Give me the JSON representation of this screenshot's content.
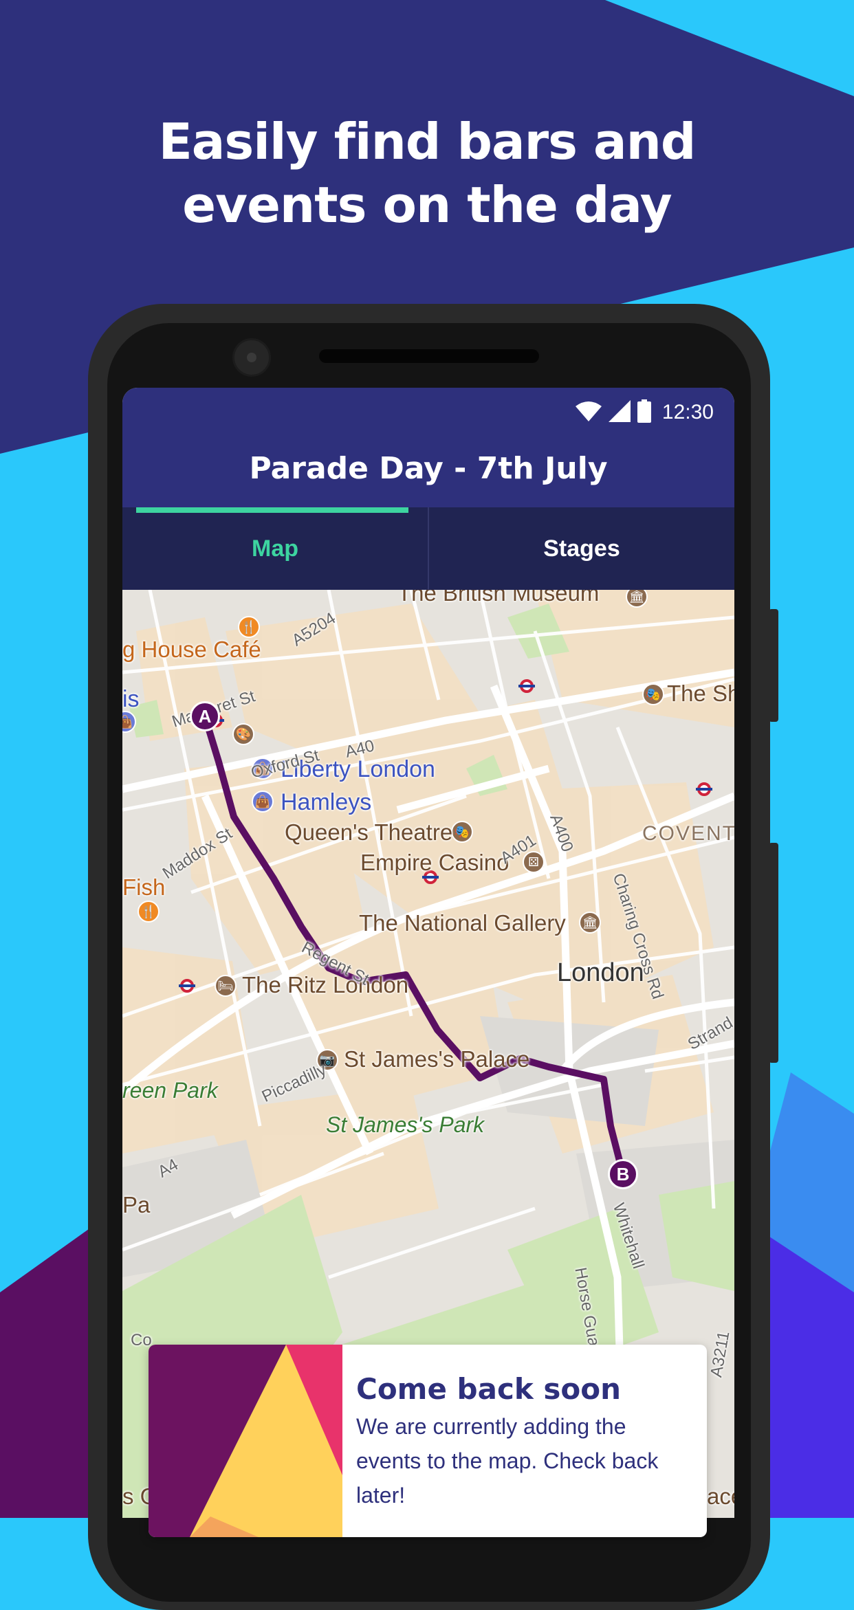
{
  "headline": {
    "line1": "Easily find bars and",
    "line2": "events on the day"
  },
  "status_bar": {
    "time": "12:30",
    "icons": [
      "wifi-icon",
      "cell-signal-icon",
      "battery-icon"
    ]
  },
  "app_bar": {
    "title": "Parade Day - 7th July"
  },
  "tabs": [
    {
      "label": "Map",
      "active": true
    },
    {
      "label": "Stages",
      "active": false
    }
  ],
  "map": {
    "places": {
      "british_museum": "The British Museum",
      "house_cafe": "g House Café",
      "is": "is",
      "the_sh": "The Sh",
      "liberty": "Liberty London",
      "hamleys": "Hamleys",
      "queens_theatre": "Queen's Theatre",
      "empire_casino": "Empire Casino",
      "fish": "Fish",
      "national_gallery": "The National Gallery",
      "london": "London",
      "ritz": "The Ritz London",
      "st_james_palace": "St James's Palace",
      "green_park": "reen Park",
      "st_james_park": "St James's Park",
      "covent": "COVENT G",
      "pa": "Pa",
      "s_g": "s G",
      "ace": "ace"
    },
    "roads": {
      "a5204": "A5204",
      "margaret_st": "Margaret St",
      "oxford_st": "Oxford St",
      "a40": "A40",
      "a400": "A400",
      "maddox_st": "Maddox St",
      "a401": "A401",
      "charing_cross_rd": "Charing Cross Rd",
      "regent_st": "Regent St",
      "strand": "Strand",
      "piccadilly": "Piccadilly",
      "a4": "A4",
      "horse_guards_rd": "Horse Guards Rd",
      "whitehall": "Whitehall",
      "a3211": "A3211",
      "constitution": "Co"
    },
    "route": {
      "start_label": "A",
      "end_label": "B",
      "color": "#5a0f62"
    }
  },
  "card": {
    "title": "Come back soon",
    "body": "We are currently adding the events to the map. Check back later!"
  },
  "colors": {
    "navy": "#2e307c",
    "tab_bg": "#202452",
    "accent_green": "#3dd4a0",
    "sky_blue": "#2ac8fb",
    "route_purple": "#5a0f62"
  }
}
